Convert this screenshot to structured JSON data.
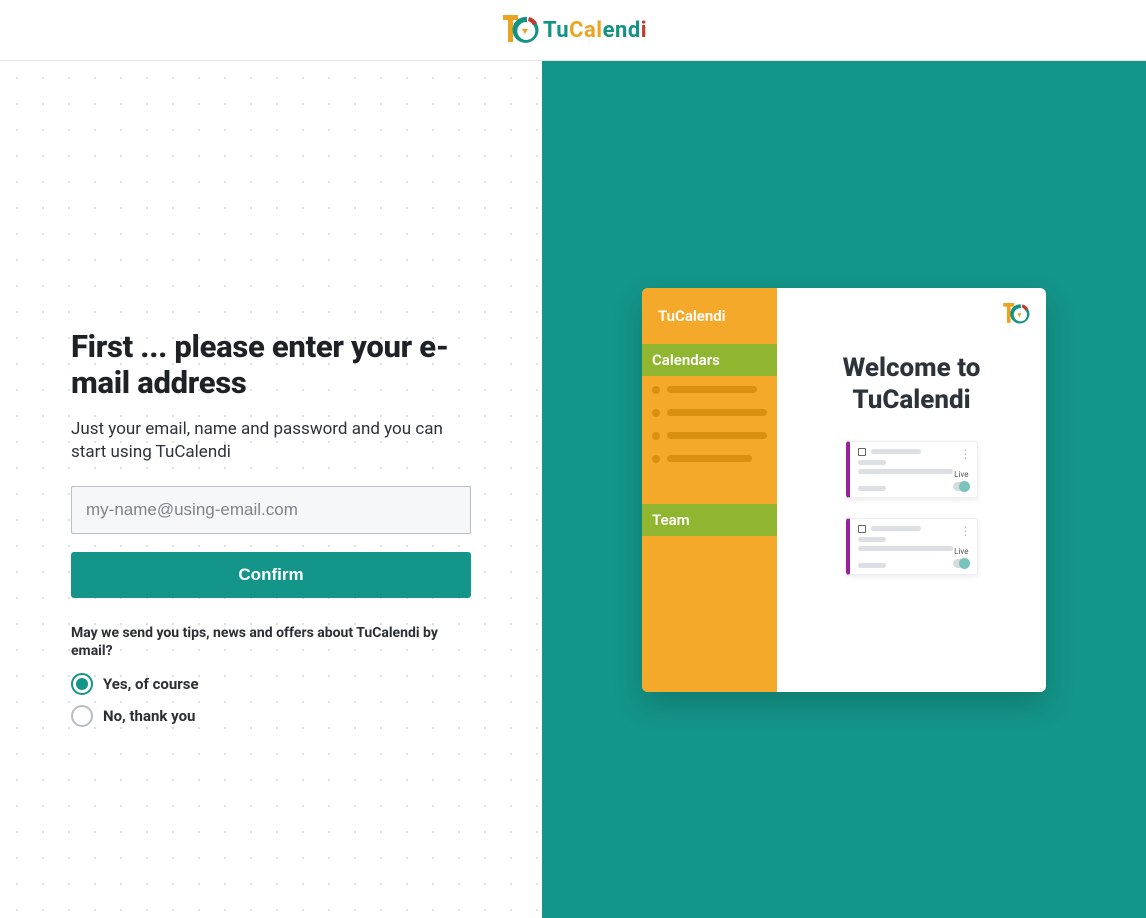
{
  "header": {
    "brand_tu": "Tu",
    "brand_cal": "Cal",
    "brand_e": "e",
    "brand_n": "n",
    "brand_d": "d",
    "brand_i": "i"
  },
  "form": {
    "title": "First ... please enter your e-mail address",
    "subtitle": "Just your email, name and password and you can start using TuCalendi",
    "email_placeholder": "my-name@using-email.com",
    "confirm_label": "Confirm",
    "consent_question": "May we send you tips, news and offers about TuCalendi by email?",
    "option_yes": "Yes, of course",
    "option_no": "No, thank you"
  },
  "mock": {
    "brand": "TuCalendi",
    "section_calendars": "Calendars",
    "section_team": "Team",
    "welcome": "Welcome to TuCalendi",
    "live_label": "Live"
  },
  "colors": {
    "teal": "#149589",
    "orange": "#f4a92a",
    "green": "#90b52f",
    "purple": "#9c1f9c"
  }
}
